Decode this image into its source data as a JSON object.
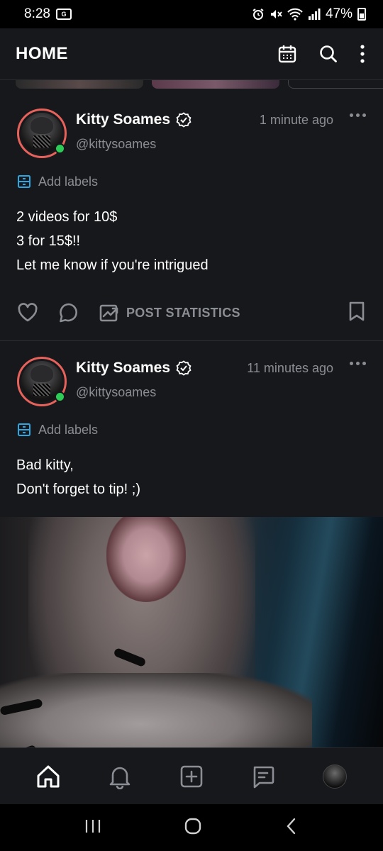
{
  "status_bar": {
    "time": "8:28",
    "left_badge": "G",
    "battery_percent": "47%"
  },
  "header": {
    "title": "HOME"
  },
  "posts": [
    {
      "display_name": "Kitty Soames",
      "handle": "@kittysoames",
      "time": "1 minute ago",
      "labels_text": "Add labels",
      "text_lines": [
        "2 videos for 10$",
        "3 for 15$!!",
        "Let me know if you're intrigued"
      ],
      "stats_label": "POST STATISTICS"
    },
    {
      "display_name": "Kitty Soames",
      "handle": "@kittysoames",
      "time": "11 minutes ago",
      "labels_text": "Add labels",
      "text_lines": [
        "Bad kitty,",
        "Don't forget to tip! ;)"
      ]
    }
  ],
  "colors": {
    "background": "#17181b",
    "muted_text": "#8a8d93",
    "accent_blue": "#2ea6e0",
    "avatar_ring": "#e6625a",
    "online": "#2ecc57"
  },
  "icons": {
    "header": [
      "calendar-icon",
      "search-icon",
      "more-vertical-icon"
    ],
    "bottom_nav": [
      "home-icon",
      "bell-icon",
      "add-post-icon",
      "messages-icon",
      "profile-avatar"
    ],
    "system_nav": [
      "recents-icon",
      "home-circle-icon",
      "back-icon"
    ]
  }
}
